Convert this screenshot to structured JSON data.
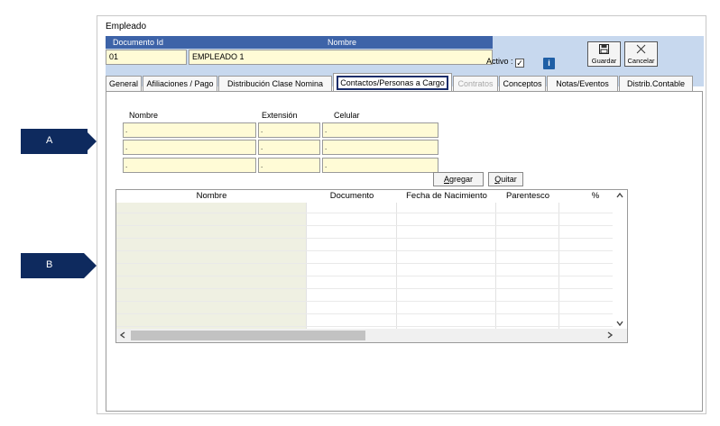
{
  "window": {
    "title": "Empleado"
  },
  "header": {
    "col_id_label": "Documento Id",
    "col_name_label": "Nombre",
    "id_value": "01",
    "name_value": "EMPLEADO 1",
    "activo_label": "Activo :",
    "activo_checked": "✓",
    "info_icon_glyph": "i",
    "save_label": "Guardar",
    "cancel_label": "Cancelar"
  },
  "tabs": [
    {
      "label": "General"
    },
    {
      "label": "Afiliaciones / Pago"
    },
    {
      "label": "Distribución Clase Nomina"
    },
    {
      "label": "Contactos/Personas a Cargo"
    },
    {
      "label": "Contratos"
    },
    {
      "label": "Conceptos"
    },
    {
      "label": "Notas/Eventos"
    },
    {
      "label": "Distrib.Contable"
    }
  ],
  "contacts": {
    "col_nombre": "Nombre",
    "col_extension": "Extensión",
    "col_celular": "Celular",
    "rows": [
      {
        "nombre": ".",
        "extension": ".",
        "celular": "."
      },
      {
        "nombre": ".",
        "extension": ".",
        "celular": "."
      },
      {
        "nombre": ".",
        "extension": ".",
        "celular": "."
      }
    ],
    "add_label": "gregar",
    "add_mnemonic": "A",
    "remove_label": "uitar",
    "remove_mnemonic": "Q"
  },
  "grid": {
    "columns": [
      "Nombre",
      "Documento",
      "Fecha de Nacimiento",
      "Parentesco",
      "%"
    ]
  },
  "callouts": {
    "a": "A",
    "b": "B"
  },
  "colors": {
    "accent": "#0e2a5e",
    "header_band": "#c7d8ee",
    "header_cell": "#3d63a8",
    "field_bg": "#fffbd6",
    "grid_first_col": "#eff0e2"
  }
}
